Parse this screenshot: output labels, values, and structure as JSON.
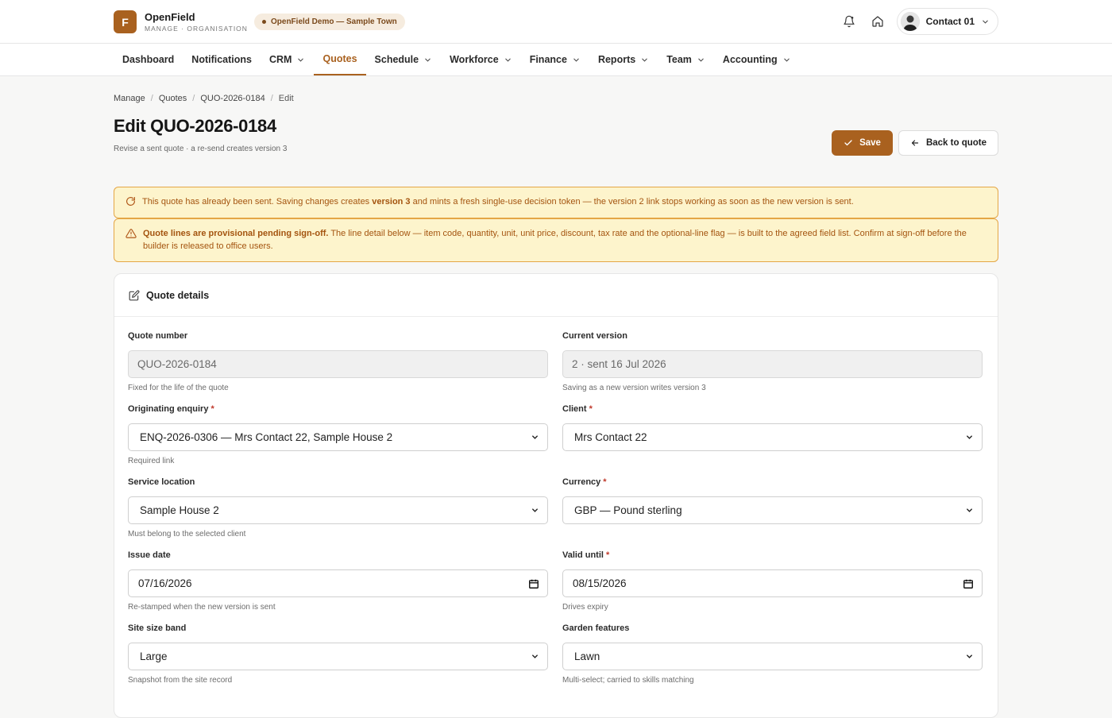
{
  "brand": {
    "logo_letter": "F",
    "name": "OpenField",
    "sub": "MANAGE · ORGANISATION",
    "accent": "#a9611f"
  },
  "tenant": {
    "label": "OpenField Demo — Sample Town"
  },
  "user": {
    "name": "Contact 01"
  },
  "nav": {
    "items": [
      {
        "label": "Dashboard"
      },
      {
        "label": "Notifications"
      },
      {
        "label": "CRM"
      },
      {
        "label": "Quotes"
      },
      {
        "label": "Schedule"
      },
      {
        "label": "Workforce"
      },
      {
        "label": "Finance"
      },
      {
        "label": "Reports"
      },
      {
        "label": "Team"
      },
      {
        "label": "Accounting"
      }
    ]
  },
  "breadcrumb": [
    "Manage",
    "Quotes",
    "QUO-2026-0184",
    "Edit"
  ],
  "page": {
    "title": "Edit QUO-2026-0184",
    "subtitle": "Revise a sent quote · a re-send creates version 3"
  },
  "actions": {
    "save": "Save",
    "back": "Back to quote"
  },
  "alerts": {
    "sent": {
      "pre": "This quote has already been sent. Saving changes creates ",
      "bold": "version 3",
      "post": " and mints a fresh single-use decision token — the version 2 link stops working as soon as the new version is sent."
    },
    "provisional": {
      "bold": "Quote lines are provisional pending sign-off.",
      "post": " The line detail below — item code, quantity, unit, unit price, discount, tax rate and the optional-line flag — is built to the agreed field list. Confirm at sign-off before the builder is released to office users."
    }
  },
  "card": {
    "title": "Quote details"
  },
  "fields": {
    "quote_number": {
      "label": "Quote number",
      "value": "QUO-2026-0184",
      "hint": "Fixed for the life of the quote"
    },
    "current_version": {
      "label": "Current version",
      "value": "2 · sent 16 Jul 2026",
      "hint": "Saving as a new version writes version 3"
    },
    "enquiry": {
      "label": "Originating enquiry",
      "value": "ENQ-2026-0306 — Mrs Contact 22, Sample House 2",
      "hint": "Required link"
    },
    "client": {
      "label": "Client",
      "value": "Mrs Contact 22",
      "hint": ""
    },
    "service_location": {
      "label": "Service location",
      "value": "Sample House 2",
      "hint": "Must belong to the selected client"
    },
    "currency": {
      "label": "Currency",
      "value": "GBP — Pound sterling",
      "hint": ""
    },
    "issue_date": {
      "label": "Issue date",
      "value": "07/16/2026",
      "hint": "Re-stamped when the new version is sent"
    },
    "valid_until": {
      "label": "Valid until",
      "value": "08/15/2026",
      "hint": "Drives expiry"
    },
    "site_size": {
      "label": "Site size band",
      "value": "Large",
      "hint": "Snapshot from the site record"
    },
    "garden_features": {
      "label": "Garden features",
      "value": "Lawn",
      "hint": "Multi-select; carried to skills matching"
    }
  }
}
